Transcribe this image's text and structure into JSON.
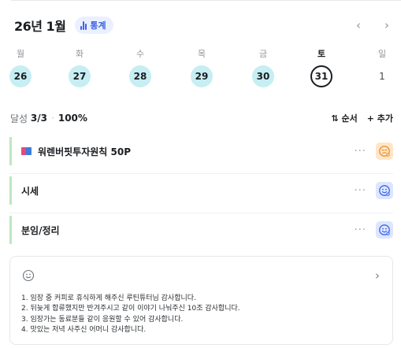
{
  "header": {
    "month_title": "26년 1월",
    "stats_label": "통계",
    "prev_arrow": "‹",
    "next_arrow": "›"
  },
  "week": {
    "labels": [
      "월",
      "화",
      "수",
      "목",
      "금",
      "토",
      "일"
    ],
    "days": [
      "26",
      "27",
      "28",
      "29",
      "30",
      "31",
      "1"
    ],
    "today_index": 5
  },
  "summary": {
    "label": "달성",
    "done_count": "3/3",
    "percent": "100%",
    "sort_label": "⇅ 순서",
    "add_label": "+ 추가"
  },
  "tasks": [
    {
      "title": "워렌버핏투자원칙 50P",
      "icon": "book-icon",
      "mood": "tired-face-icon",
      "mood_color": "orange",
      "more": "···"
    },
    {
      "title": "시세",
      "icon": null,
      "mood": "smile-face-icon",
      "mood_color": "blue",
      "more": "···"
    },
    {
      "title": "분임/정리",
      "icon": null,
      "mood": "smile-face-icon",
      "mood_color": "blue",
      "more": "···"
    }
  ],
  "note": {
    "lines": [
      "1. 임장 중 커피로 휴식하게 해주신 루틴튜터님 감사합니다.",
      "2. 뒤늦게 합류했지만 반겨주시고 같이 이야기 나눠주신 10조 감사합니다.",
      "3. 임장가는 동료분들 같이 응원할 수 있어 감사합니다.",
      "4. 맛있는 저녁 사주신 어머니 감사합니다."
    ],
    "chevron": "›"
  },
  "colors": {
    "day_fill": "#c6eef3",
    "accent_blue": "#3a63e6",
    "task_border": "#bfe6c0"
  }
}
